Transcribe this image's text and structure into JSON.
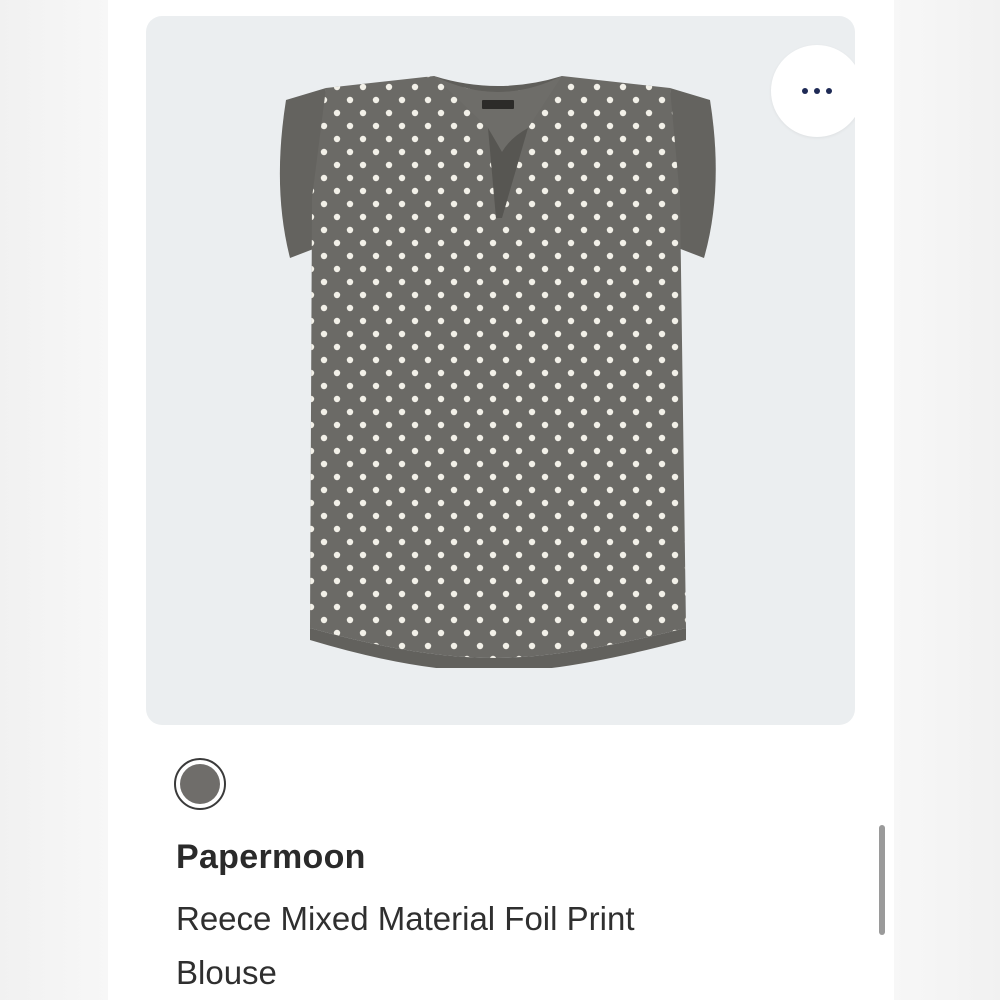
{
  "product": {
    "brand": "Papermoon",
    "name": "Reece Mixed Material Foil Print Blouse",
    "image_alt": "Grey short-sleeve blouse with white dot print",
    "colors": {
      "card_bg": "#ebeef0",
      "garment": "#6b6a66",
      "dots": "#f2f0e8",
      "swatch_selected": "#6f6d6a"
    }
  },
  "actions": {
    "more_icon": "more-horizontal-icon"
  },
  "color_swatches": [
    {
      "color": "#6f6d6a",
      "selected": true
    }
  ]
}
